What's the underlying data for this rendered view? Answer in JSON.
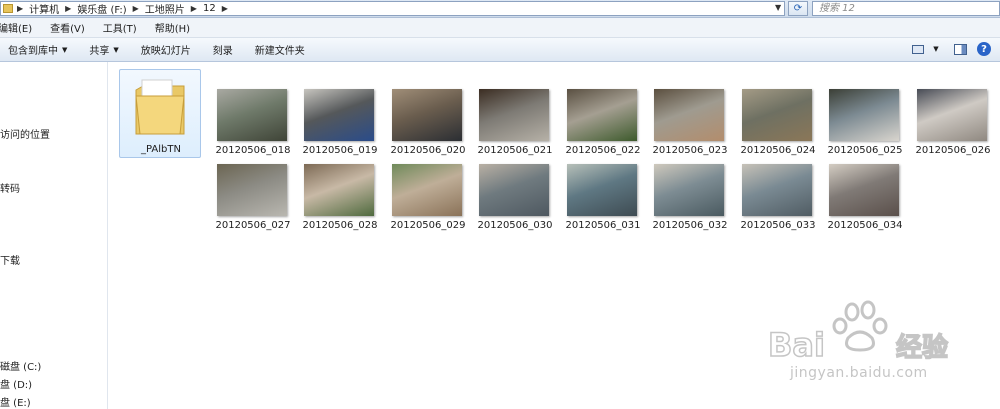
{
  "address": {
    "crumbs": [
      "计算机",
      "娱乐盘 (F:)",
      "工地照片",
      "12"
    ]
  },
  "search": {
    "placeholder": "搜索 12"
  },
  "menu": {
    "edit": "编辑(E)",
    "view": "查看(V)",
    "tools": "工具(T)",
    "help": "帮助(H)"
  },
  "toolbar": {
    "include_library": "包含到库中",
    "share": "共享",
    "slideshow": "放映幻灯片",
    "burn": "刻录",
    "new_folder": "新建文件夹"
  },
  "nav": {
    "items": [
      "",
      "访问的位置",
      "转码",
      "下载",
      "",
      "磁盘 (C:)",
      "盘 (D:)",
      "盘 (E:)"
    ]
  },
  "folder": {
    "name": "_PAlbTN"
  },
  "files": [
    {
      "name": "20120506_018",
      "colors": [
        "#6f7a6a",
        "#a9a9a2",
        "#3f4437"
      ]
    },
    {
      "name": "20120506_019",
      "colors": [
        "#55585a",
        "#c7c5bf",
        "#2a4c8a"
      ]
    },
    {
      "name": "20120506_020",
      "colors": [
        "#6a5d4e",
        "#a08e78",
        "#2b2e33"
      ]
    },
    {
      "name": "20120506_021",
      "colors": [
        "#7d7a74",
        "#3b2d22",
        "#b6b1a7"
      ]
    },
    {
      "name": "20120506_022",
      "colors": [
        "#a59f92",
        "#5a5042",
        "#3d5a2c"
      ]
    },
    {
      "name": "20120506_023",
      "colors": [
        "#9f9b90",
        "#5b4f3f",
        "#b38d6c"
      ]
    },
    {
      "name": "20120506_024",
      "colors": [
        "#6e7062",
        "#a49b86",
        "#8b7758"
      ]
    },
    {
      "name": "20120506_025",
      "colors": [
        "#7c8a92",
        "#3b3f36",
        "#d9d5ce"
      ]
    },
    {
      "name": "20120506_026",
      "colors": [
        "#cfcac4",
        "#474b55",
        "#8f8880"
      ]
    },
    {
      "name": "20120506_027",
      "colors": [
        "#8c8b84",
        "#6b6552",
        "#b9b7b0"
      ]
    },
    {
      "name": "20120506_028",
      "colors": [
        "#c8b9a6",
        "#7d6a55",
        "#4f6a3e"
      ]
    },
    {
      "name": "20120506_029",
      "colors": [
        "#bfae98",
        "#6f8a5a",
        "#8a7258"
      ]
    },
    {
      "name": "20120506_030",
      "colors": [
        "#6f7a7f",
        "#b9b0a4",
        "#4e5860"
      ]
    },
    {
      "name": "20120506_031",
      "colors": [
        "#5f7883",
        "#b7c0b9",
        "#3e4b52"
      ]
    },
    {
      "name": "20120506_032",
      "colors": [
        "#7d8c93",
        "#cfc9bd",
        "#4a5a60"
      ]
    },
    {
      "name": "20120506_033",
      "colors": [
        "#7a8a93",
        "#c7c2b8",
        "#505c63"
      ]
    },
    {
      "name": "20120506_034",
      "colors": [
        "#807a76",
        "#d4cdc3",
        "#5a4f4a"
      ]
    }
  ],
  "watermark": {
    "text": "jingyan.baidu.com",
    "logo": "Bai du 经验"
  },
  "colors": {
    "accent": "#2a64c8",
    "selection": "#ddeefd"
  }
}
